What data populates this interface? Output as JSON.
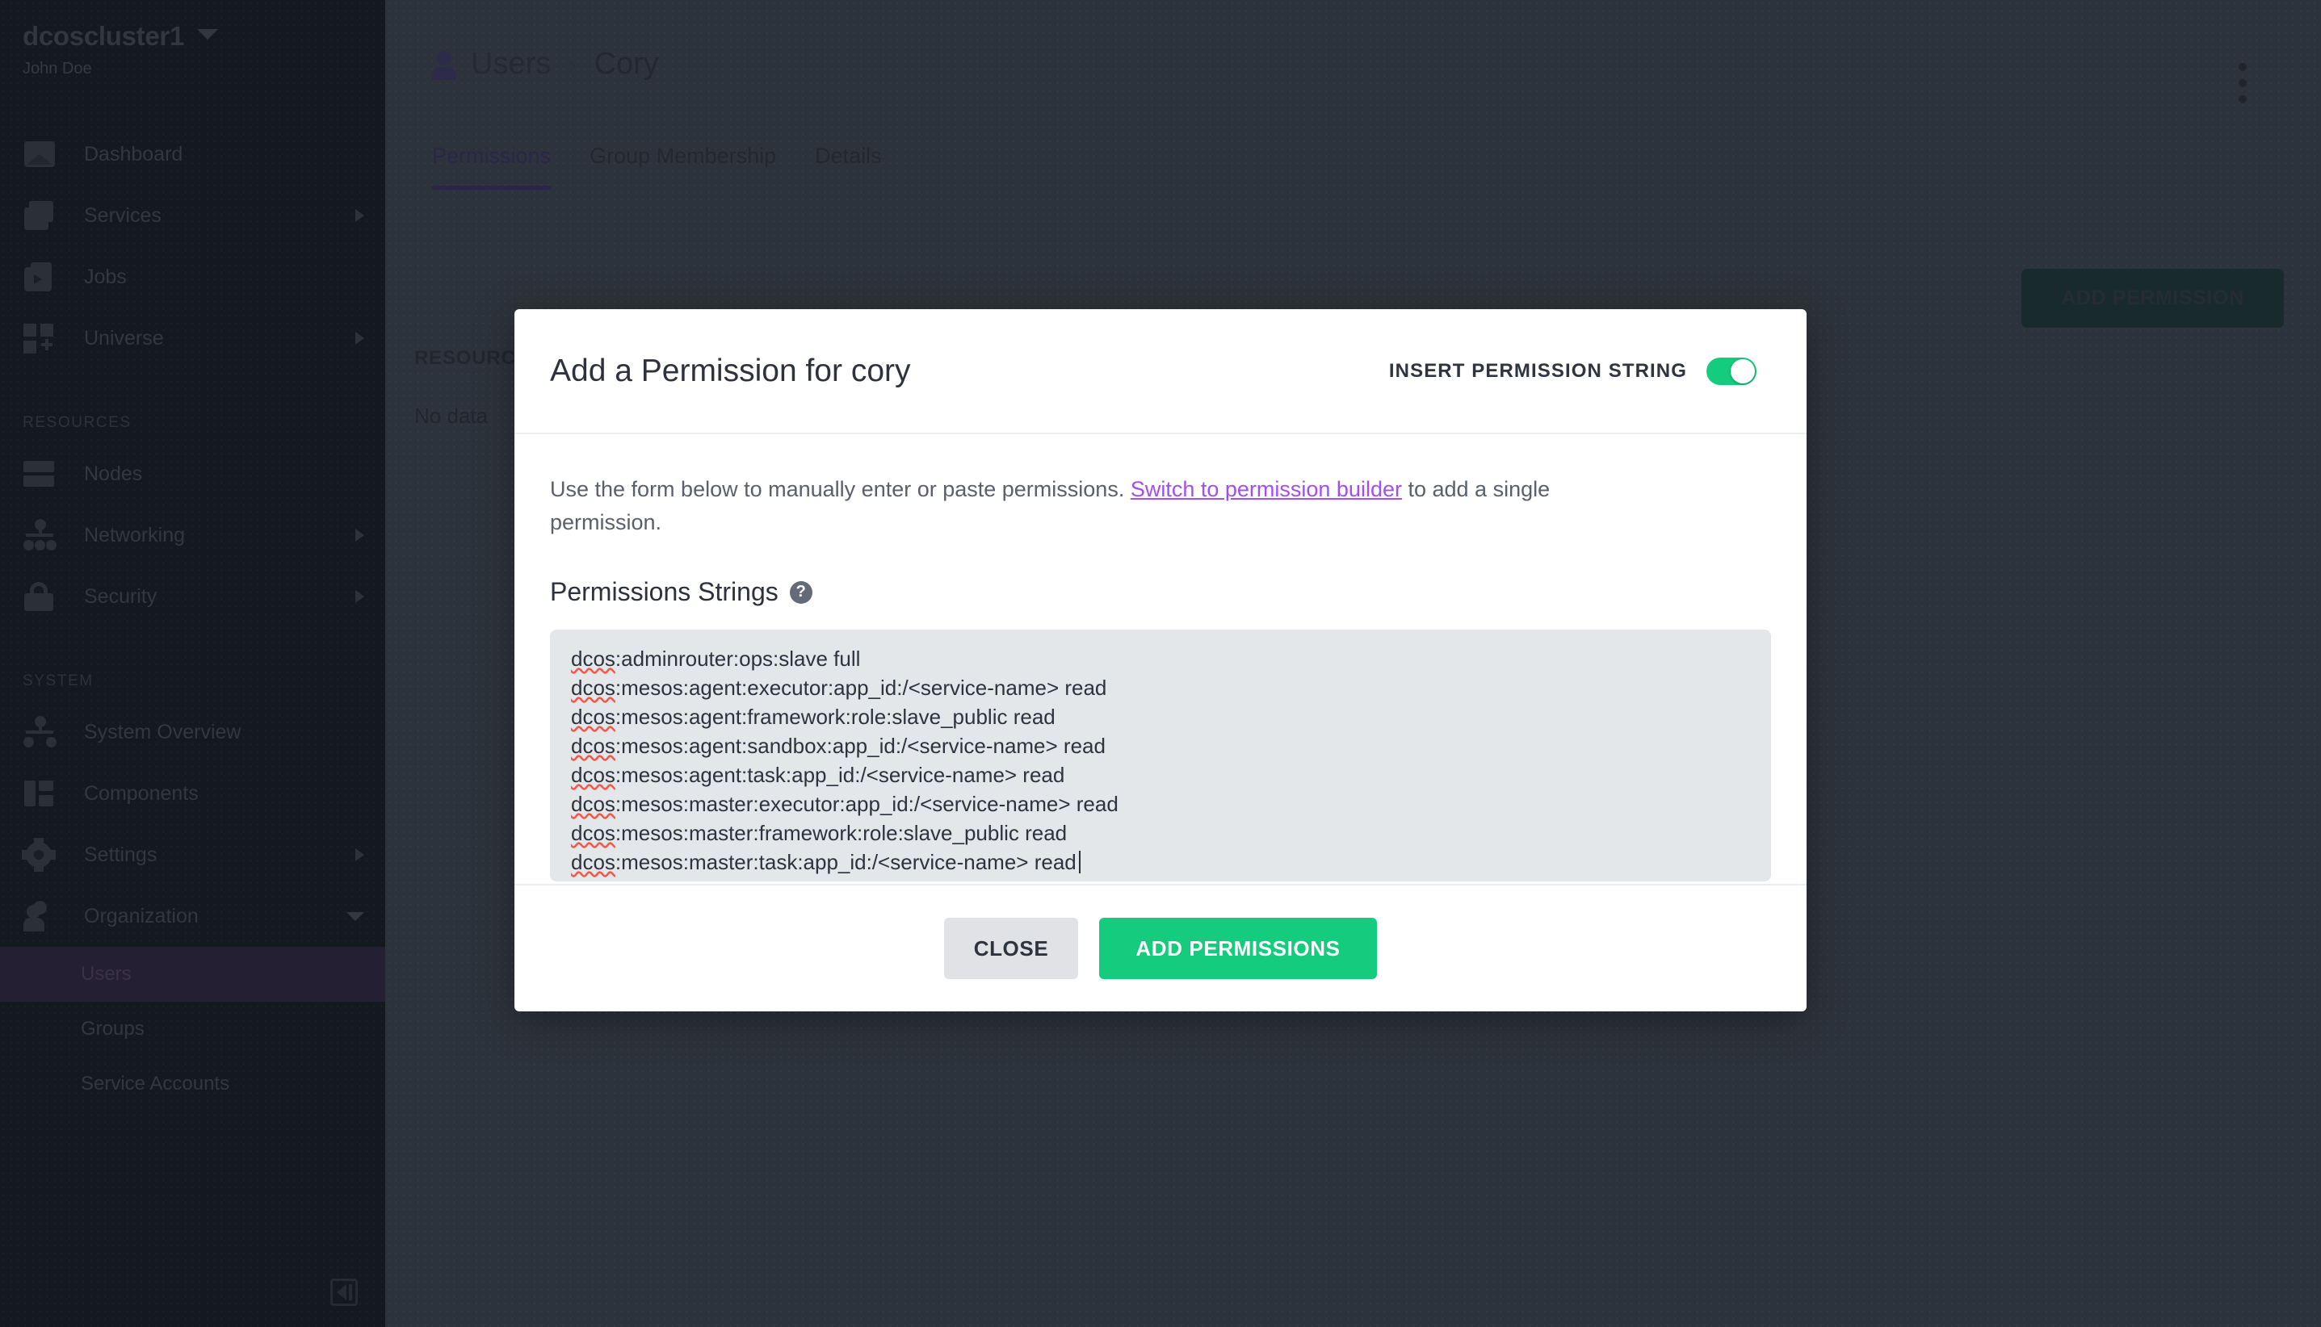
{
  "sidebar": {
    "cluster_name": "dcoscluster1",
    "user_name": "John Doe",
    "nav": [
      {
        "label": "Dashboard",
        "icon": "dashboard-icon",
        "expandable": false
      },
      {
        "label": "Services",
        "icon": "services-icon",
        "expandable": true
      },
      {
        "label": "Jobs",
        "icon": "jobs-icon",
        "expandable": false
      },
      {
        "label": "Universe",
        "icon": "universe-icon",
        "expandable": true
      }
    ],
    "resources_heading": "RESOURCES",
    "resources": [
      {
        "label": "Nodes",
        "icon": "nodes-icon",
        "expandable": false
      },
      {
        "label": "Networking",
        "icon": "networking-icon",
        "expandable": true
      },
      {
        "label": "Security",
        "icon": "lock-icon",
        "expandable": true
      }
    ],
    "system_heading": "SYSTEM",
    "system": [
      {
        "label": "System Overview",
        "icon": "system-overview-icon",
        "expandable": false
      },
      {
        "label": "Components",
        "icon": "components-icon",
        "expandable": false
      },
      {
        "label": "Settings",
        "icon": "gear-icon",
        "expandable": true
      },
      {
        "label": "Organization",
        "icon": "organization-icon",
        "expandable": true,
        "expanded": true
      }
    ],
    "organization_children": [
      {
        "label": "Users",
        "active": true
      },
      {
        "label": "Groups",
        "active": false
      },
      {
        "label": "Service Accounts",
        "active": false
      }
    ]
  },
  "page": {
    "breadcrumb_root": "Users",
    "breadcrumb_separator": "›",
    "breadcrumb_current": "Cory",
    "tabs": [
      {
        "label": "Permissions",
        "active": true
      },
      {
        "label": "Group Membership",
        "active": false
      },
      {
        "label": "Details",
        "active": false
      }
    ],
    "add_permission_label": "ADD PERMISSION",
    "table_header": "RESOURCE",
    "table_empty": "No data"
  },
  "modal": {
    "title": "Add a Permission for cory",
    "toggle_label": "INSERT PERMISSION STRING",
    "toggle_on": true,
    "description_before": "Use the form below to manually enter or paste permissions. ",
    "description_link": "Switch to permission builder",
    "description_after": " to add a single permission.",
    "field_label": "Permissions Strings",
    "help_icon_glyph": "?",
    "permissions_lines": [
      "dcos:adminrouter:ops:slave full",
      "dcos:mesos:agent:executor:app_id:/<service-name> read",
      "dcos:mesos:agent:framework:role:slave_public read",
      "dcos:mesos:agent:sandbox:app_id:/<service-name> read",
      "dcos:mesos:agent:task:app_id:/<service-name> read",
      "dcos:mesos:master:executor:app_id:/<service-name> read",
      "dcos:mesos:master:framework:role:slave_public read",
      "dcos:mesos:master:task:app_id:/<service-name> read"
    ],
    "close_label": "CLOSE",
    "add_permissions_label": "ADD  PERMISSIONS"
  },
  "colors": {
    "accent_green": "#15cb7d",
    "link_purple": "#a44df0",
    "sidebar_bg": "#14181f",
    "main_bg": "#2d333c",
    "modal_bg": "#ffffff",
    "textarea_bg": "#e4e7ea",
    "spellcheck_red": "#f2584a"
  }
}
